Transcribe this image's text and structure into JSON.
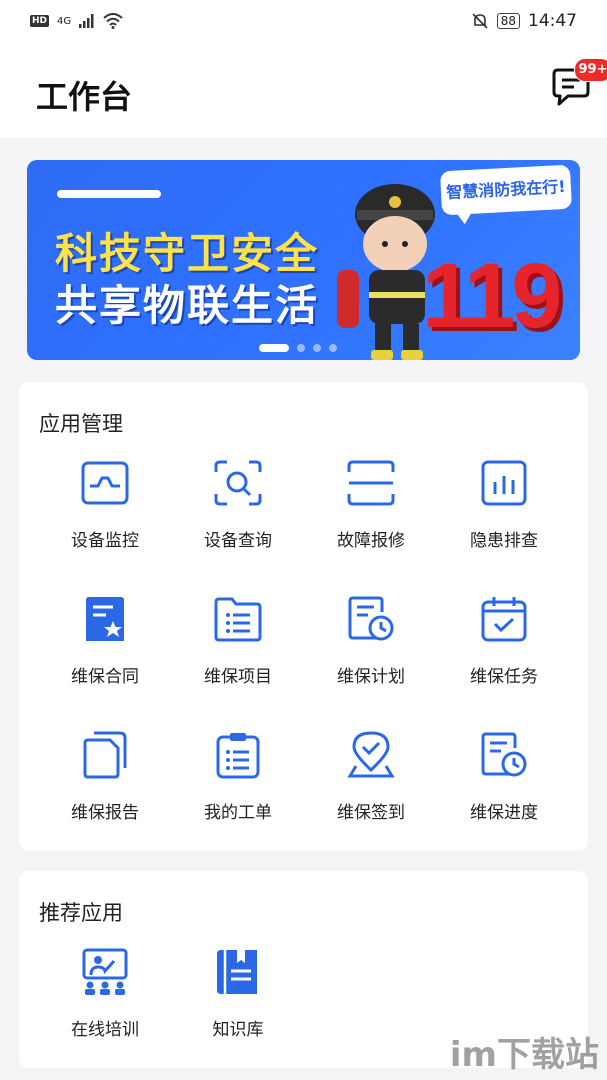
{
  "status_bar": {
    "hd": "HD",
    "net": "4G",
    "battery": "88",
    "time": "14:47"
  },
  "header": {
    "title": "工作台",
    "badge": "99+"
  },
  "banner": {
    "line1": "科技守卫安全",
    "line2": "共享物联生活",
    "bubble": "智慧消防我在行!",
    "number": "119"
  },
  "app_management": {
    "title": "应用管理",
    "items": [
      {
        "label": "设备监控",
        "icon": "monitor-icon"
      },
      {
        "label": "设备查询",
        "icon": "scan-search-icon"
      },
      {
        "label": "故障报修",
        "icon": "scan-frame-icon"
      },
      {
        "label": "隐患排查",
        "icon": "bar-chart-icon"
      },
      {
        "label": "维保合同",
        "icon": "contract-icon"
      },
      {
        "label": "维保项目",
        "icon": "folder-list-icon"
      },
      {
        "label": "维保计划",
        "icon": "document-clock-icon"
      },
      {
        "label": "维保任务",
        "icon": "calendar-check-icon"
      },
      {
        "label": "维保报告",
        "icon": "copy-document-icon"
      },
      {
        "label": "我的工单",
        "icon": "clipboard-list-icon"
      },
      {
        "label": "维保签到",
        "icon": "location-check-icon"
      },
      {
        "label": "维保进度",
        "icon": "document-clock-icon"
      }
    ]
  },
  "recommended": {
    "title": "推荐应用",
    "items": [
      {
        "label": "在线培训",
        "icon": "training-icon"
      },
      {
        "label": "知识库",
        "icon": "book-icon"
      }
    ]
  },
  "watermark": "im下载站",
  "colors": {
    "accent": "#2b68e6",
    "badge": "#ee2b2b"
  }
}
